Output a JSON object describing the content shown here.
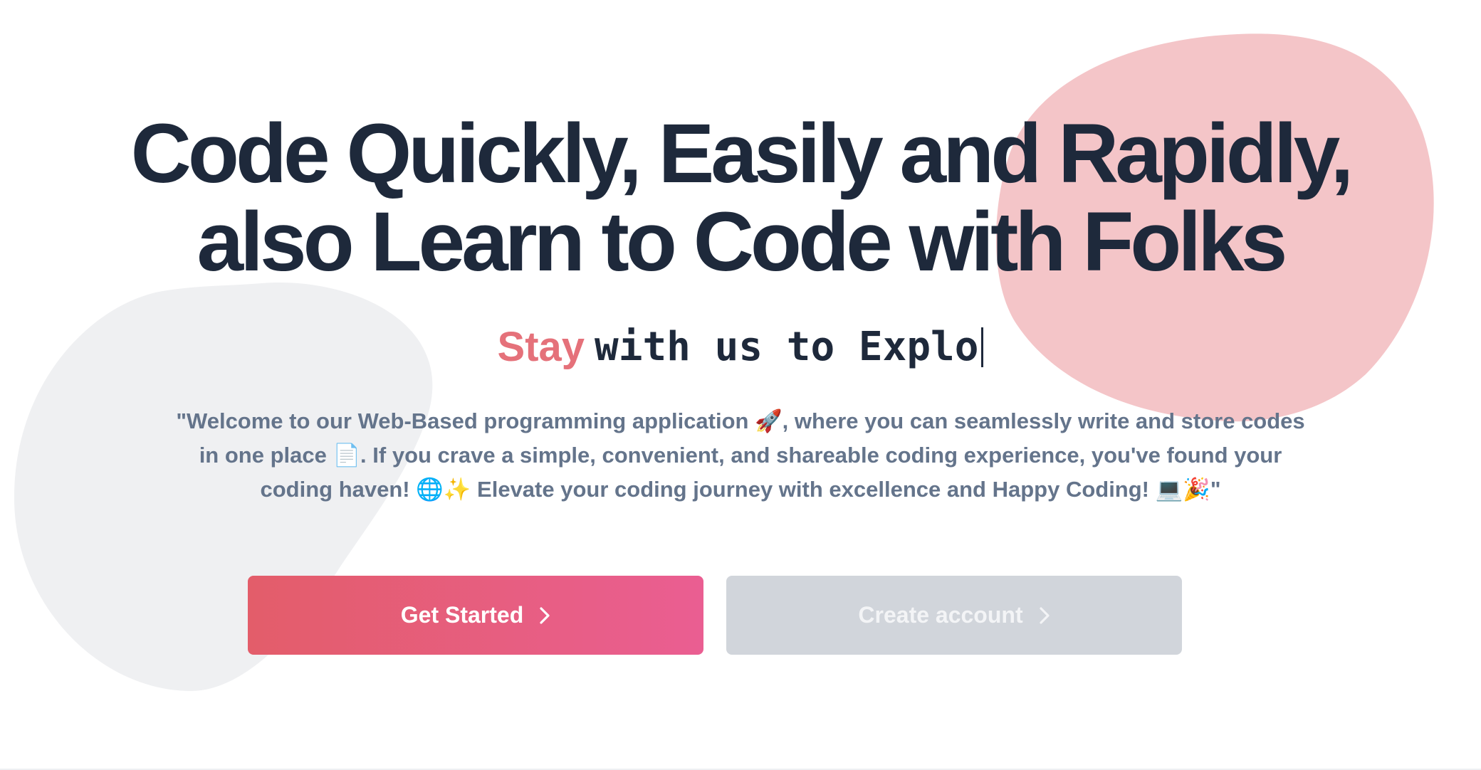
{
  "hero": {
    "headline_line1": "Code Quickly, Easily and Rapidly,",
    "headline_line2": "also Learn to Code with Folks",
    "typing_accent": "Stay",
    "typing_text": "with us to Explo",
    "intro": "\"Welcome to our Web-Based programming application 🚀, where you can seamlessly write and store codes in one place 📄. If you crave a simple, convenient, and shareable coding experience, you've found your coding haven! 🌐✨ Elevate your coding journey with excellence and Happy Coding! 💻🎉\""
  },
  "buttons": {
    "get_started": "Get Started",
    "create_account": "Create account"
  },
  "icons": {
    "button_chevron": "chevron-right-icon",
    "typing_caret": "text-caret"
  },
  "colors": {
    "headline": "#1e293b",
    "accent": "#e5717a",
    "intro_text": "#64748b",
    "primary_gradient_start": "#e35d6a",
    "primary_gradient_end": "#ea5e92",
    "secondary_button": "#d1d5db",
    "pink_blob": "#f4c5c8",
    "gray_blob": "#eff0f2"
  }
}
